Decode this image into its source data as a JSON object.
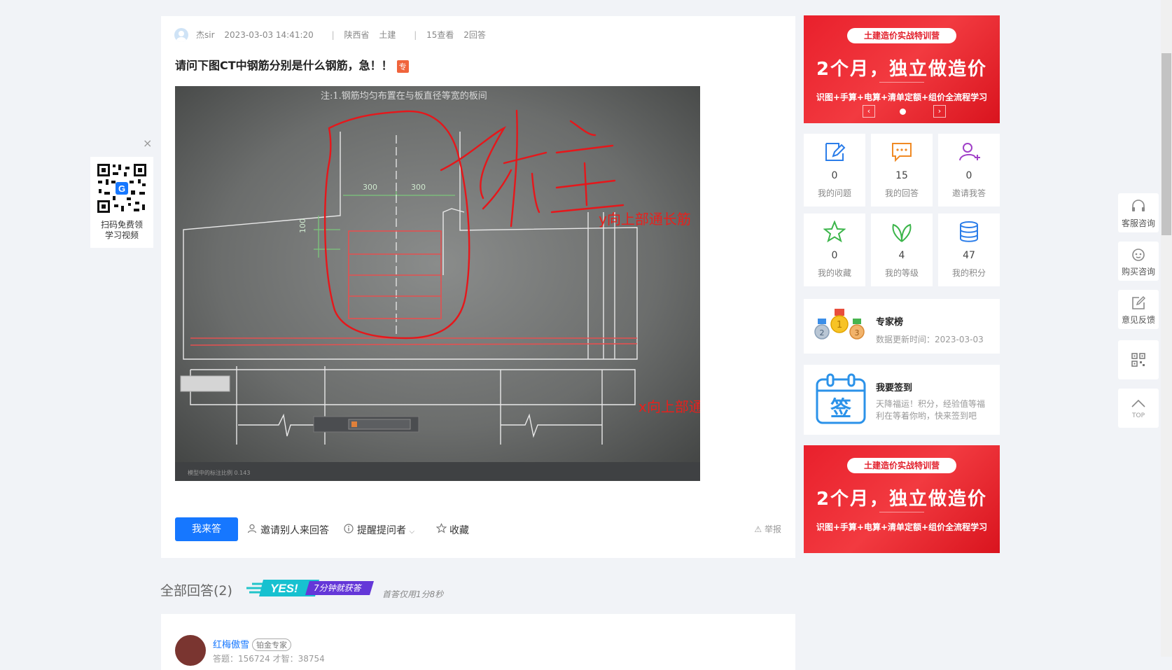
{
  "question": {
    "author": "杰sir",
    "datetime": "2023-03-03 14:41:20",
    "region": "陕西省",
    "category": "土建",
    "views": "15查看",
    "answers_count": "2回答",
    "title": "请问下图CT中钢筋分别是什么钢筋，急！！",
    "tag": "专",
    "annotations": {
      "top_note": "注:1.钢筋均匀布置在与板直径等宽的板间",
      "dim_300a": "300",
      "dim_300b": "300",
      "dim_100": "100",
      "handwriting": "柱",
      "y_label": "y向上部通长筋",
      "x_label": "x向上部通长筋",
      "status_text": "模型中的标注比例 0.143"
    }
  },
  "actions": {
    "answer": "我来答",
    "invite": "邀请别人来回答",
    "remind": "提醒提问者",
    "favorite": "收藏",
    "report": "举报"
  },
  "answers": {
    "title": "全部回答(2)",
    "badge_text": "7分钟就获答",
    "badge_yes": "YES!",
    "first_time": "首答仅用1分8秒",
    "first": {
      "name": "红梅傲雪",
      "level": "铂金专家",
      "stats": "答题：156724    才智：38754"
    }
  },
  "banner": {
    "pill": "土建造价实战特训营",
    "headline": "2个月，独立做造价",
    "sub": "识图+手算+电算+清单定额+组价全流程学习"
  },
  "stats": [
    {
      "num": "0",
      "label": "我的问题",
      "icon": "edit-icon"
    },
    {
      "num": "15",
      "label": "我的回答",
      "icon": "chat-icon"
    },
    {
      "num": "0",
      "label": "邀请我答",
      "icon": "user-add-icon"
    },
    {
      "num": "0",
      "label": "我的收藏",
      "icon": "star-icon"
    },
    {
      "num": "4",
      "label": "我的等级",
      "icon": "leaf-icon"
    },
    {
      "num": "47",
      "label": "我的积分",
      "icon": "database-icon"
    }
  ],
  "expert": {
    "title": "专家榜",
    "sub": "数据更新时间：2023-03-03"
  },
  "signin": {
    "title": "我要签到",
    "sub": "天降福运！积分，经验值等福利在等着你哟，快来签到吧",
    "icon_char": "签"
  },
  "qr": {
    "text1": "扫码免费领",
    "text2": "学习视频",
    "close": "×"
  },
  "tools": [
    {
      "label": "客服咨询",
      "icon": "headset-icon"
    },
    {
      "label": "购买咨询",
      "icon": "robot-icon"
    },
    {
      "label": "意见反馈",
      "icon": "feedback-icon"
    },
    {
      "label": "",
      "icon": "qrcode-icon"
    },
    {
      "label": "TOP",
      "icon": "top-icon"
    }
  ],
  "colors": {
    "primary": "#1677ff",
    "banner_red": "#e9202c",
    "annotation_red": "#e8201c"
  }
}
